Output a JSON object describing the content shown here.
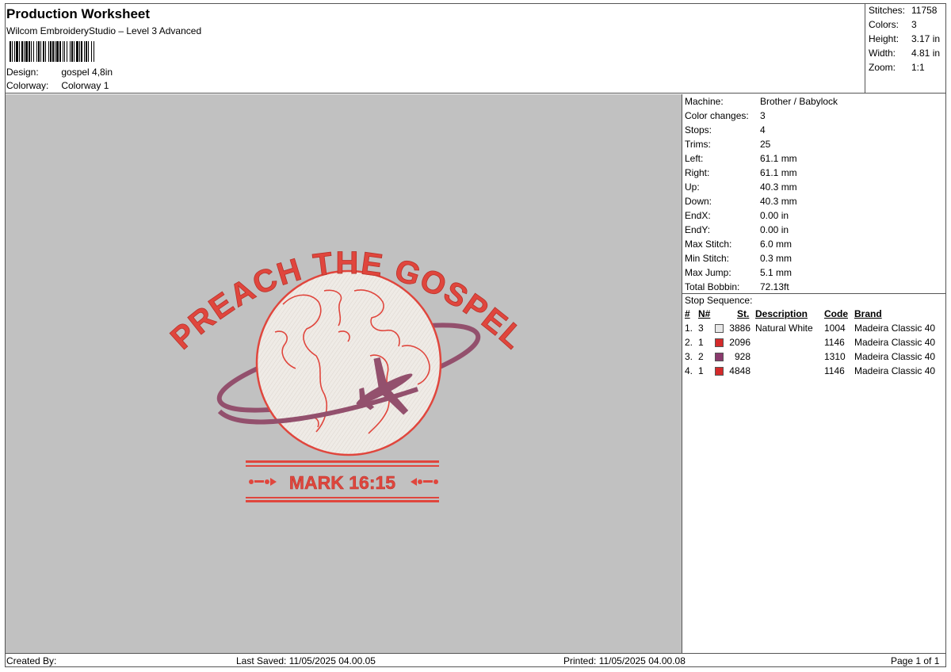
{
  "header": {
    "title": "Production Worksheet",
    "subtitle": "Wilcom EmbroideryStudio – Level 3 Advanced",
    "design_label": "Design:",
    "design_value": "gospel 4,8in",
    "colorway_label": "Colorway:",
    "colorway_value": "Colorway 1"
  },
  "summary": [
    {
      "label": "Stitches:",
      "value": "11758"
    },
    {
      "label": "Colors:",
      "value": "3"
    },
    {
      "label": "Height:",
      "value": "3.17 in"
    },
    {
      "label": "Width:",
      "value": "4.81 in"
    },
    {
      "label": "Zoom:",
      "value": "1:1"
    }
  ],
  "machine_info": [
    {
      "label": "Machine:",
      "value": "Brother / Babylock"
    },
    {
      "label": "Color changes:",
      "value": "3"
    },
    {
      "label": "Stops:",
      "value": "4"
    },
    {
      "label": "Trims:",
      "value": "25"
    },
    {
      "label": "Left:",
      "value": "61.1 mm"
    },
    {
      "label": "Right:",
      "value": "61.1 mm"
    },
    {
      "label": "Up:",
      "value": "40.3 mm"
    },
    {
      "label": "Down:",
      "value": "40.3 mm"
    },
    {
      "label": "EndX:",
      "value": "0.00 in"
    },
    {
      "label": "EndY:",
      "value": "0.00 in"
    },
    {
      "label": "Max Stitch:",
      "value": "6.0 mm"
    },
    {
      "label": "Min Stitch:",
      "value": "0.3 mm"
    },
    {
      "label": "Max Jump:",
      "value": "5.1 mm"
    },
    {
      "label": "Total Bobbin:",
      "value": "72.13ft"
    }
  ],
  "stop_sequence": {
    "title": "Stop Sequence:",
    "headers": {
      "num": "#",
      "n": "N#",
      "st": "St.",
      "description": "Description",
      "code": "Code",
      "brand": "Brand"
    },
    "rows": [
      {
        "num": "1.",
        "n": "3",
        "color": "#e8e8e8",
        "st": "3886",
        "description": "Natural White",
        "code": "1004",
        "brand": "Madeira Classic 40"
      },
      {
        "num": "2.",
        "n": "1",
        "color": "#d42a2a",
        "st": "2096",
        "description": "",
        "code": "1146",
        "brand": "Madeira Classic 40"
      },
      {
        "num": "3.",
        "n": "2",
        "color": "#8a3a6e",
        "st": "928",
        "description": "",
        "code": "1310",
        "brand": "Madeira Classic 40"
      },
      {
        "num": "4.",
        "n": "1",
        "color": "#d42a2a",
        "st": "4848",
        "description": "",
        "code": "1146",
        "brand": "Madeira Classic 40"
      }
    ]
  },
  "design": {
    "arc_text": "PREACH THE GOSPEL",
    "verse_text": "MARK 16:15",
    "colors": {
      "red": "#e0463d",
      "purple": "#93506d",
      "white": "#f0ece8",
      "background": "#c1c1c1"
    }
  },
  "footer": {
    "created_by": "Created By:",
    "last_saved": "Last Saved: 11/05/2025 04.00.05",
    "printed": "Printed: 11/05/2025 04.00.08",
    "page": "Page 1 of 1"
  }
}
